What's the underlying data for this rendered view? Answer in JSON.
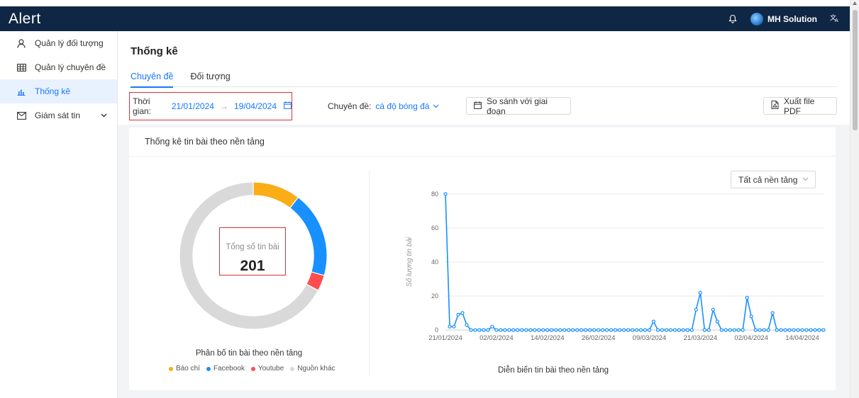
{
  "header": {
    "logo": "Alert",
    "user_name": "MH Solution"
  },
  "sidebar": {
    "items": [
      {
        "label": "Quản lý đối tượng"
      },
      {
        "label": "Quản lý chuyên đề"
      },
      {
        "label": "Thống kê"
      },
      {
        "label": "Giám sát tin"
      }
    ]
  },
  "page": {
    "title": "Thống kê",
    "tabs": [
      {
        "label": "Chuyên đề"
      },
      {
        "label": "Đối tượng"
      }
    ]
  },
  "filters": {
    "time_label": "Thời gian:",
    "date_from": "21/01/2024",
    "date_to": "19/04/2024",
    "topic_label": "Chuyên đề:",
    "topic_value": "cá độ bóng đá",
    "compare_button": "So sánh với giai đoạn",
    "export_button": "Xuất file PDF"
  },
  "card": {
    "title": "Thống kê tin bài theo nền tảng",
    "total_label": "Tổng số tin bài",
    "total_value": "201",
    "pie_caption": "Phân bố tin bài theo nền tảng",
    "platform_select": "Tất cả nền tảng",
    "line_caption": "Diễn biến tin bài theo nền tảng"
  },
  "chart_data": [
    {
      "type": "pie",
      "subtype": "donut",
      "title": "Phân bố tin bài theo nền tảng",
      "categories": [
        "Báo chí",
        "Facebook",
        "Youtube",
        "Nguồn khác"
      ],
      "values": [
        21,
        38,
        7,
        135
      ],
      "colors": [
        "#faad14",
        "#1890ff",
        "#ff4d4f",
        "#d9d9d9"
      ],
      "center_label": "Tổng số tin bài",
      "center_value": 201
    },
    {
      "type": "line",
      "title": "Diễn biến tin bài theo nền tảng",
      "ylabel": "Số lượng tin bài",
      "xlabel": "",
      "ylim": [
        0,
        80
      ],
      "yticks": [
        0,
        20,
        40,
        60,
        80
      ],
      "xticks": [
        "21/01/2024",
        "02/02/2024",
        "14/02/2024",
        "26/02/2024",
        "09/03/2024",
        "21/03/2024",
        "02/04/2024",
        "14/04/2024"
      ],
      "color": "#1890ff",
      "grid": true,
      "x_start": "21/01/2024",
      "x_end": "19/04/2024",
      "values": [
        80,
        2,
        2,
        9,
        10,
        3,
        0,
        0,
        0,
        0,
        0,
        2,
        0,
        0,
        0,
        0,
        0,
        0,
        0,
        0,
        0,
        0,
        0,
        0,
        0,
        0,
        0,
        0,
        0,
        0,
        0,
        0,
        0,
        0,
        0,
        0,
        0,
        0,
        0,
        0,
        0,
        0,
        0,
        0,
        0,
        0,
        0,
        0,
        0,
        5,
        0,
        0,
        0,
        0,
        0,
        0,
        0,
        0,
        0,
        12,
        22,
        0,
        0,
        12,
        5,
        0,
        0,
        0,
        0,
        0,
        0,
        19,
        8,
        0,
        0,
        0,
        0,
        10,
        0,
        0,
        0,
        0,
        0,
        0,
        0,
        0,
        0,
        0,
        0,
        0
      ]
    }
  ]
}
